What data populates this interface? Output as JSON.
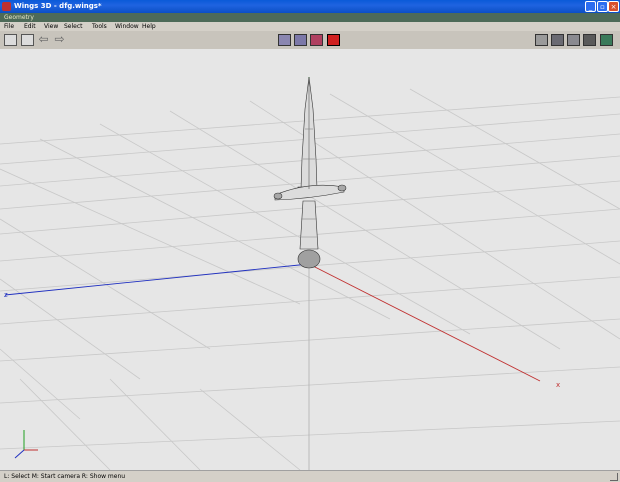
{
  "window": {
    "title": "Wings 3D - dfg.wings*"
  },
  "mode_bar": {
    "label": "Geometry"
  },
  "menu": {
    "items": [
      "File",
      "Edit",
      "View",
      "Select",
      "Tools",
      "Window",
      "Help"
    ]
  },
  "toolbar": {
    "left_icons": [
      "open-file-icon",
      "save-file-icon",
      "undo-arrow-icon",
      "redo-arrow-icon"
    ],
    "selection_modes": [
      "vertex-select-icon",
      "edge-select-icon",
      "face-select-icon",
      "body-select-icon"
    ],
    "active_selection_mode": "body-select-icon",
    "view_icons": [
      "workmode-icon",
      "smooth-shaded-icon",
      "wireframe-icon",
      "orthographic-icon",
      "axes-icon"
    ]
  },
  "viewport": {
    "axes": {
      "x_color": "#c03030",
      "y_color": "#20a020",
      "z_color": "#2030c0",
      "x_label": "x",
      "z_label": "z"
    }
  },
  "status": {
    "text": "L: Select   M: Start camera   R: Show menu"
  }
}
